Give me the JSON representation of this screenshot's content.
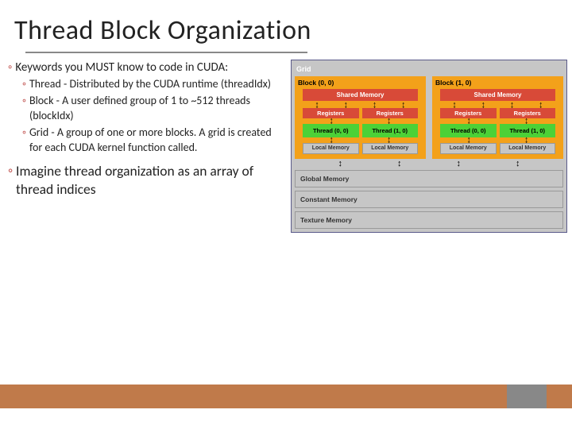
{
  "title": "Thread Block Organization",
  "bullets": {
    "main": "Keywords you MUST know to code in CUDA:",
    "sub": [
      "Thread - Distributed by the CUDA runtime (threadIdx)",
      "Block - A user defined group of 1 to ~512 threads (blockIdx)",
      "Grid - A group of one or more blocks. A grid is created for each CUDA kernel function called."
    ],
    "imagine": "Imagine thread organization as an array of thread indices"
  },
  "diagram": {
    "grid": "Grid",
    "blocks": [
      {
        "label": "Block (0, 0)",
        "threads": [
          "Thread (0, 0)",
          "Thread (1, 0)"
        ]
      },
      {
        "label": "Block (1, 0)",
        "threads": [
          "Thread (0, 0)",
          "Thread (1, 0)"
        ]
      }
    ],
    "shared": "Shared Memory",
    "registers": "Registers",
    "local": "Local Memory",
    "global": "Global Memory",
    "constant": "Constant Memory",
    "texture": "Texture Memory"
  }
}
